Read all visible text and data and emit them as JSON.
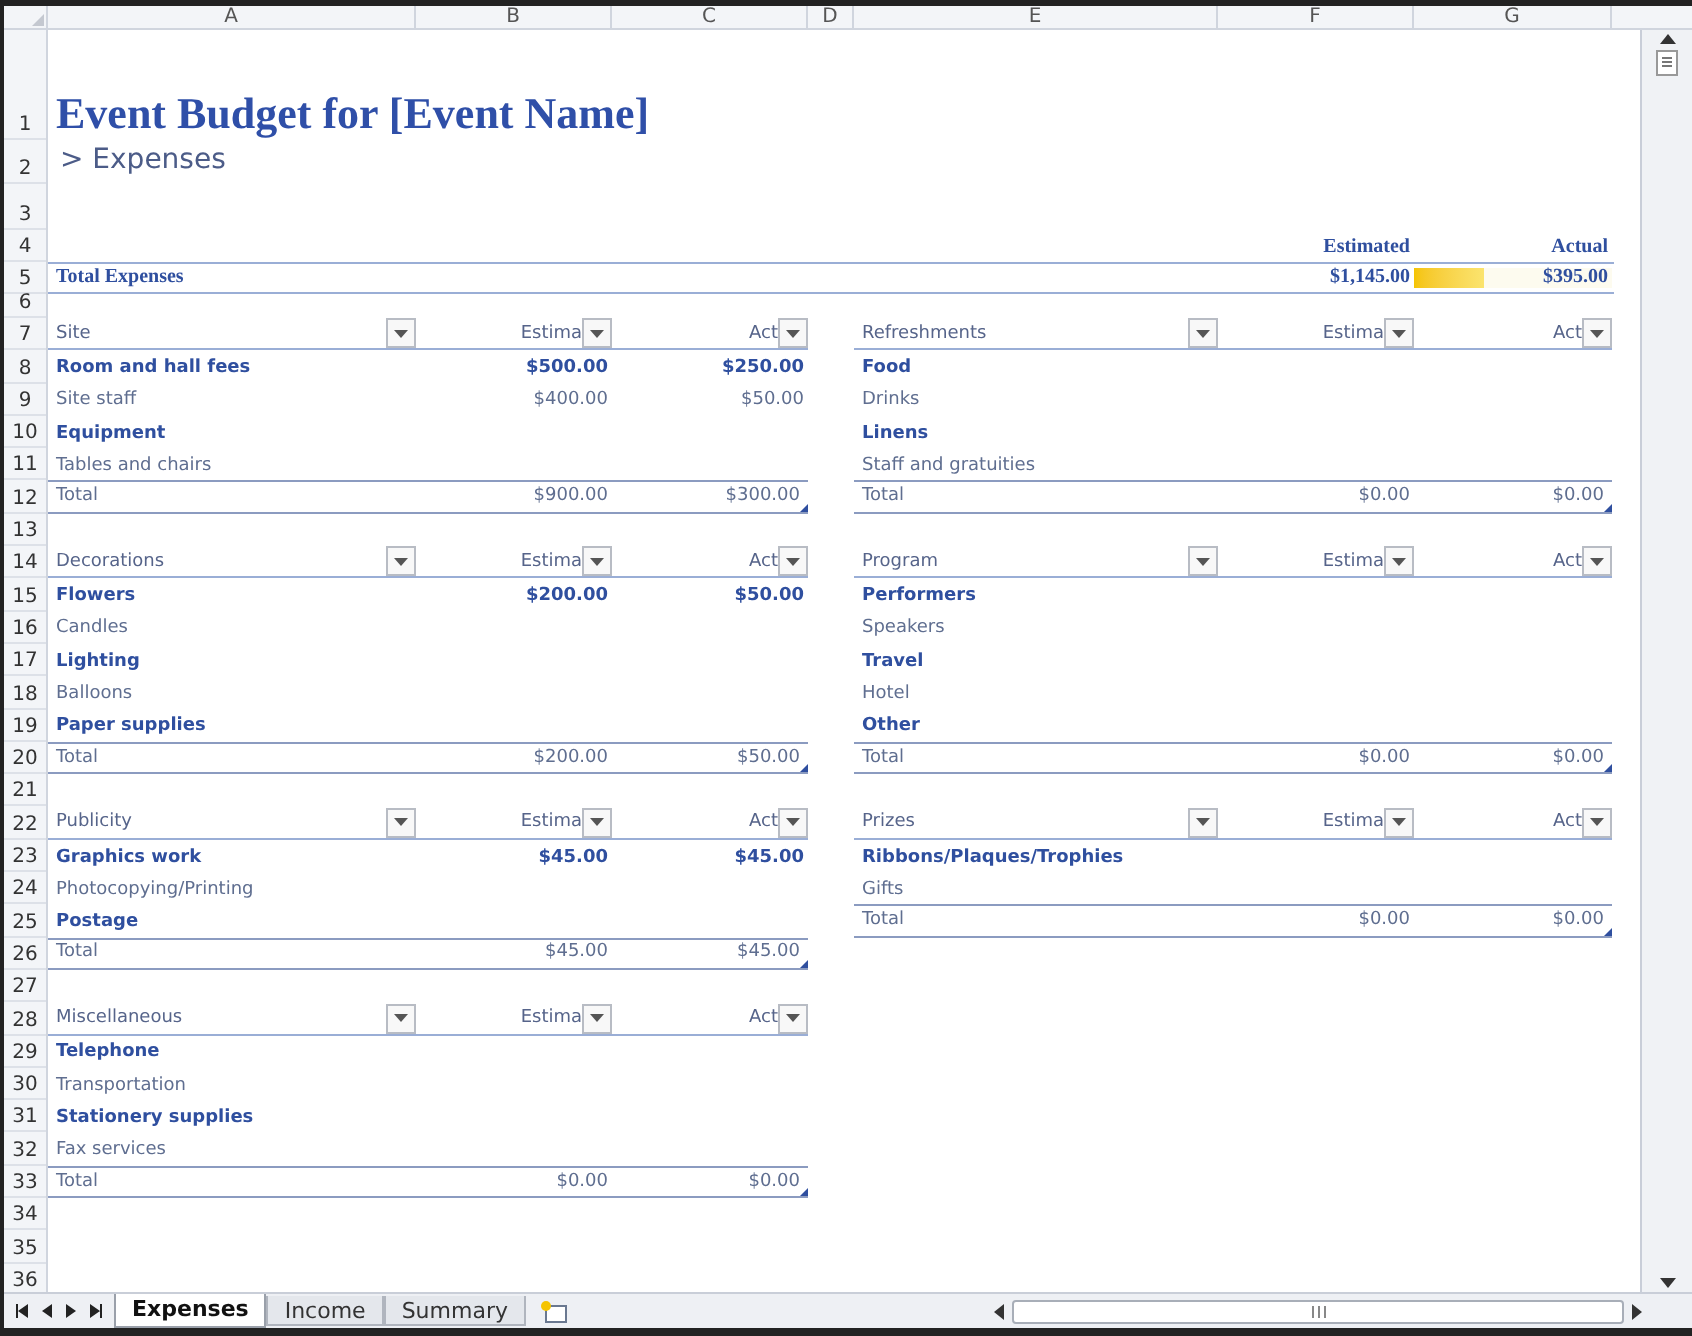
{
  "column_headers": [
    "A",
    "B",
    "C",
    "D",
    "E",
    "F",
    "G"
  ],
  "row_numbers": [
    "1",
    "2",
    "3",
    "4",
    "5",
    "6",
    "7",
    "8",
    "9",
    "10",
    "11",
    "12",
    "13",
    "14",
    "15",
    "16",
    "17",
    "18",
    "19",
    "20",
    "21",
    "22",
    "23",
    "24",
    "25",
    "26",
    "27",
    "28",
    "29",
    "30",
    "31",
    "32",
    "33",
    "34",
    "35",
    "36"
  ],
  "title": "Event Budget for [Event Name]",
  "subtitle": "> Expenses",
  "summary": {
    "estimated_label": "Estimated",
    "actual_label": "Actual",
    "label": "Total Expenses",
    "estimated": "$1,145.00",
    "actual": "$395.00",
    "level": 0.35
  },
  "left_sections": [
    {
      "name": "Site",
      "estimated_header": "Estima",
      "actual_header": "Act",
      "items": [
        {
          "label": "Room and hall fees",
          "estimated": "$500.00",
          "actual": "$250.00",
          "bold": true
        },
        {
          "label": "Site staff",
          "estimated": "$400.00",
          "actual": "$50.00",
          "bold": false
        },
        {
          "label": "Equipment",
          "bold": true
        },
        {
          "label": "Tables and chairs",
          "bold": false
        }
      ],
      "total_label": "Total",
      "total_estimated": "$900.00",
      "total_actual": "$300.00"
    },
    {
      "name": "Decorations",
      "estimated_header": "Estima",
      "actual_header": "Act",
      "items": [
        {
          "label": "Flowers",
          "estimated": "$200.00",
          "actual": "$50.00",
          "bold": true
        },
        {
          "label": "Candles",
          "bold": false
        },
        {
          "label": "Lighting",
          "bold": true
        },
        {
          "label": "Balloons",
          "bold": false
        },
        {
          "label": "Paper supplies",
          "bold": true
        }
      ],
      "total_label": "Total",
      "total_estimated": "$200.00",
      "total_actual": "$50.00"
    },
    {
      "name": "Publicity",
      "estimated_header": "Estima",
      "actual_header": "Act",
      "items": [
        {
          "label": "Graphics work",
          "estimated": "$45.00",
          "actual": "$45.00",
          "bold": true
        },
        {
          "label": "Photocopying/Printing",
          "bold": false
        },
        {
          "label": "Postage",
          "bold": true
        }
      ],
      "total_label": "Total",
      "total_estimated": "$45.00",
      "total_actual": "$45.00"
    },
    {
      "name": "Miscellaneous",
      "estimated_header": "Estima",
      "actual_header": "Act",
      "items": [
        {
          "label": "Telephone",
          "bold": true
        },
        {
          "label": "Transportation",
          "bold": false
        },
        {
          "label": "Stationery supplies",
          "bold": true
        },
        {
          "label": "Fax services",
          "bold": false
        }
      ],
      "total_label": "Total",
      "total_estimated": "$0.00",
      "total_actual": "$0.00"
    }
  ],
  "right_sections": [
    {
      "name": "Refreshments",
      "estimated_header": "Estima",
      "actual_header": "Act",
      "items": [
        {
          "label": "Food",
          "bold": true
        },
        {
          "label": "Drinks",
          "bold": false
        },
        {
          "label": "Linens",
          "bold": true
        },
        {
          "label": "Staff and gratuities",
          "bold": false
        }
      ],
      "total_label": "Total",
      "total_estimated": "$0.00",
      "total_actual": "$0.00"
    },
    {
      "name": "Program",
      "estimated_header": "Estima",
      "actual_header": "Act",
      "items": [
        {
          "label": "Performers",
          "bold": true
        },
        {
          "label": "Speakers",
          "bold": false
        },
        {
          "label": "Travel",
          "bold": true
        },
        {
          "label": "Hotel",
          "bold": false
        },
        {
          "label": "Other",
          "bold": true
        }
      ],
      "total_label": "Total",
      "total_estimated": "$0.00",
      "total_actual": "$0.00"
    },
    {
      "name": "Prizes",
      "estimated_header": "Estima",
      "actual_header": "Act",
      "items": [
        {
          "label": "Ribbons/Plaques/Trophies",
          "bold": true
        },
        {
          "label": "Gifts",
          "bold": false
        }
      ],
      "total_label": "Total",
      "total_estimated": "$0.00",
      "total_actual": "$0.00"
    }
  ],
  "sheet_tabs": [
    {
      "label": "Expenses",
      "selected": true
    },
    {
      "label": "Income",
      "selected": false
    },
    {
      "label": "Summary",
      "selected": false
    }
  ]
}
